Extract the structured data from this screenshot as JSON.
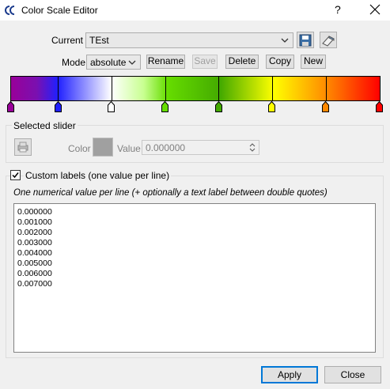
{
  "window": {
    "title": "Color Scale Editor",
    "help_label": "?"
  },
  "current": {
    "label": "Current",
    "value": "TEst"
  },
  "mode": {
    "label": "Mode",
    "value": "absolute"
  },
  "buttons": {
    "rename": "Rename",
    "save": "Save",
    "delete": "Delete",
    "copy": "Copy",
    "new": "New",
    "apply": "Apply",
    "close": "Close"
  },
  "slider_colors": [
    "#990099",
    "#2020ff",
    "#ffffff",
    "#66dd00",
    "#44aa00",
    "#ffff00",
    "#ff8800",
    "#ff0000"
  ],
  "selected_slider": {
    "title": "Selected slider",
    "color_label": "Color",
    "value_label": "Value",
    "value": "0.000000",
    "color_swatch": "#a0a0a0"
  },
  "custom_labels": {
    "checkbox_label": "Custom labels (one value per line)",
    "checked": true,
    "hint": "One numerical value per line (+ optionally a text label between double quotes)",
    "lines": [
      "0.000000",
      "0.001000",
      "0.002000",
      "0.003000",
      "0.004000",
      "0.005000",
      "0.006000",
      "0.007000"
    ]
  }
}
